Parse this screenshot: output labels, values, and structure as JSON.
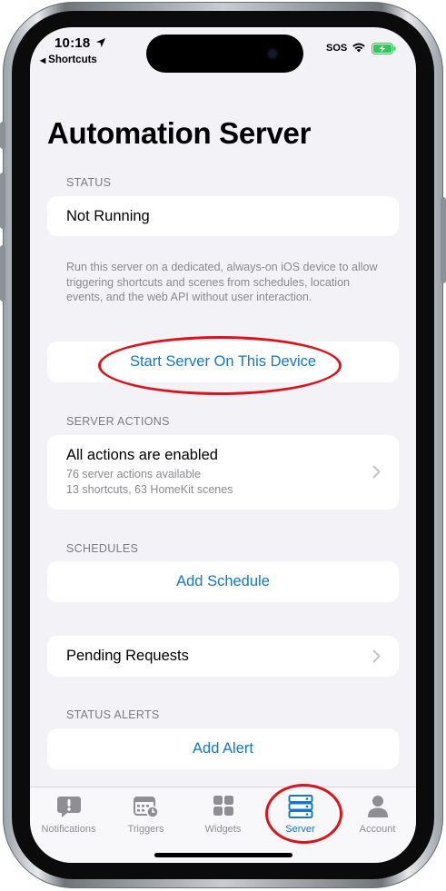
{
  "status_bar": {
    "time": "10:18",
    "back_app": "Shortcuts",
    "carrier": "SOS"
  },
  "page": {
    "title": "Automation Server"
  },
  "status_section": {
    "header": "STATUS",
    "value": "Not Running",
    "footnote": "Run this server on a dedicated, always-on iOS device to allow triggering shortcuts and scenes from schedules, location events, and the web API without user interaction.",
    "start_button": "Start Server On This Device"
  },
  "server_actions": {
    "header": "SERVER ACTIONS",
    "title": "All actions are enabled",
    "line1": "76 server actions available",
    "line2": "13 shortcuts, 63 HomeKit scenes"
  },
  "schedules": {
    "header": "SCHEDULES",
    "add_button": "Add Schedule"
  },
  "pending": {
    "label": "Pending Requests"
  },
  "status_alerts": {
    "header": "STATUS ALERTS",
    "add_button": "Add Alert"
  },
  "tabs": [
    {
      "label": "Notifications",
      "icon": "exclamation-bubble-icon",
      "active": false
    },
    {
      "label": "Triggers",
      "icon": "calendar-clock-icon",
      "active": false
    },
    {
      "label": "Widgets",
      "icon": "grid-icon",
      "active": false
    },
    {
      "label": "Server",
      "icon": "server-icon",
      "active": true
    },
    {
      "label": "Account",
      "icon": "person-icon",
      "active": false
    }
  ],
  "colors": {
    "accent": "#1677c4",
    "annotation": "#d8141c",
    "background": "#f2f2f7",
    "inactive_tab": "#8e8e93",
    "battery": "#34c759"
  }
}
